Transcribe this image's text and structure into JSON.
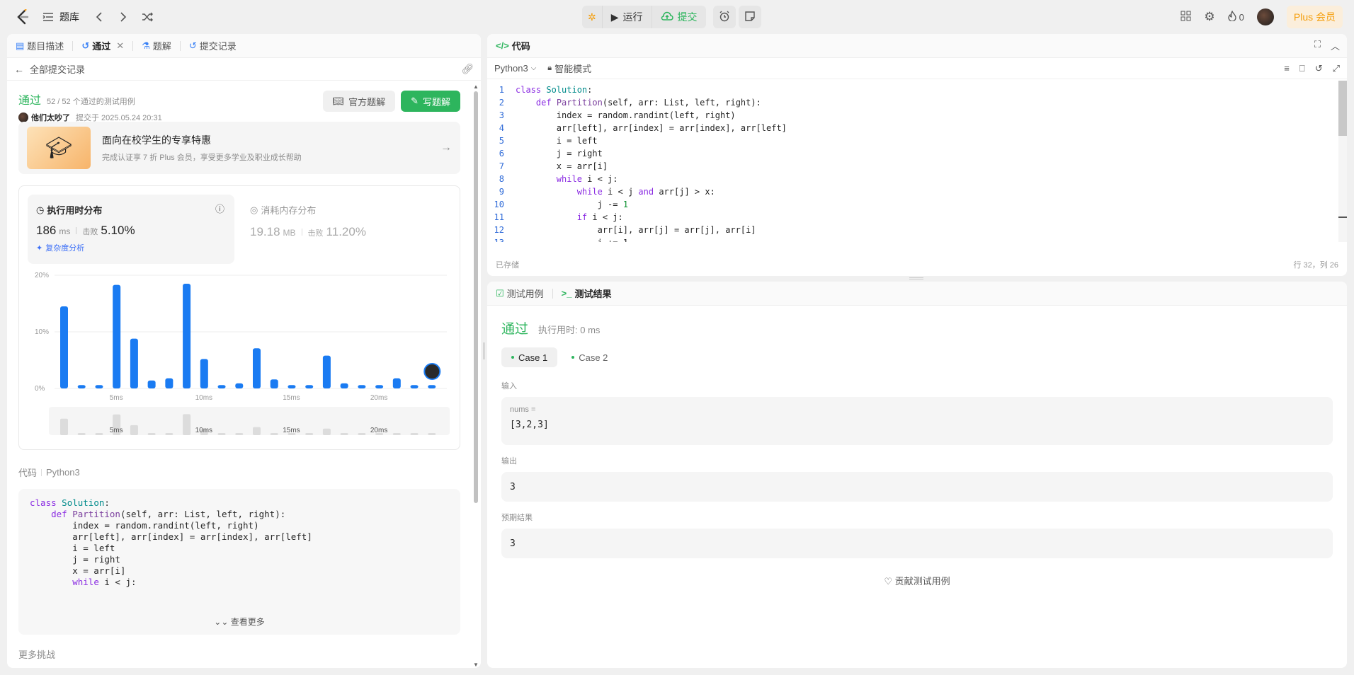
{
  "topbar": {
    "problem_bank": "题库",
    "run": "运行",
    "submit": "提交",
    "streak": "0",
    "plus": "Plus 会员"
  },
  "left": {
    "tabs": [
      "题目描述",
      "通过",
      "题解",
      "提交记录"
    ],
    "back": "全部提交记录",
    "status": "通过",
    "cases": "52 / 52 个通过的测试用例",
    "user": "他们太吵了",
    "submitted": "提交于 2025.05.24 20:31",
    "official": "官方题解",
    "write": "写题解",
    "promo_title": "面向在校学生的专享特惠",
    "promo_sub": "完成认证享 7 折 Plus 会员，享受更多学业及职业成长帮助",
    "runtime_title": "执行用时分布",
    "runtime_val": "186",
    "runtime_unit": "ms",
    "beats_label": "击败",
    "runtime_beats": "5.10%",
    "complexity": "复杂度分析",
    "mem_title": "消耗内存分布",
    "mem_val": "19.18",
    "mem_unit": "MB",
    "mem_beats": "11.20%",
    "code_label": "代码",
    "lang": "Python3",
    "see_more": "查看更多",
    "more": "更多挑战",
    "code": [
      "class Solution:",
      "    def Partition(self, arr: List, left, right):",
      "        index = random.randint(left, right)",
      "        arr[left], arr[index] = arr[index], arr[left]",
      "        i = left",
      "        j = right",
      "        x = arr[i]",
      "        while i < j:"
    ]
  },
  "chart_data": {
    "type": "bar",
    "yticks": [
      "20%",
      "10%",
      "0%"
    ],
    "xticks": [
      "5ms",
      "10ms",
      "15ms",
      "20ms"
    ],
    "ylim": [
      0,
      20
    ],
    "values": [
      14.5,
      0.6,
      0.6,
      18.3,
      8.8,
      1.4,
      1.8,
      18.5,
      5.2,
      0.6,
      0.9,
      7.1,
      1.6,
      0.6,
      0.6,
      5.8,
      0.9,
      0.6,
      0.6,
      1.8,
      0.6,
      0.6
    ],
    "highlight_index": 21
  },
  "editor": {
    "title": "代码",
    "lang": "Python3",
    "mode": "智能模式",
    "saved": "已存储",
    "pos": "行 32，列 26"
  },
  "tests": {
    "tabs": [
      "测试用例",
      "测试结果"
    ],
    "status": "通过",
    "time": "执行用时: 0 ms",
    "case1": "Case 1",
    "case2": "Case 2",
    "input_label": "输入",
    "var": "nums =",
    "input": "[3,2,3]",
    "output_label": "输出",
    "output": "3",
    "expected_label": "预期结果",
    "expected": "3",
    "contribute": "贡献测试用例"
  }
}
